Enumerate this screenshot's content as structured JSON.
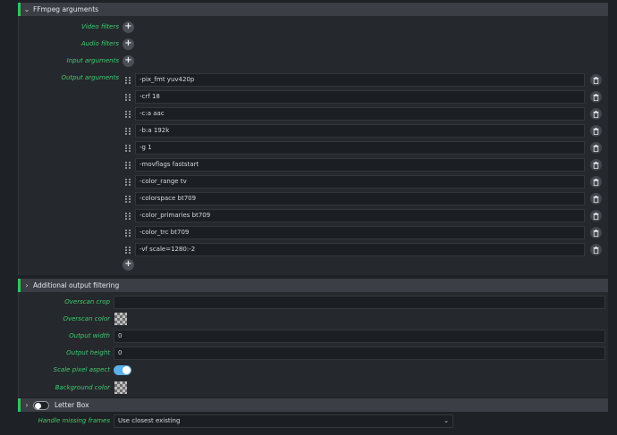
{
  "ffmpeg_section": {
    "title": "FFmpeg arguments",
    "video_filters_label": "Video filters",
    "audio_filters_label": "Audio filters",
    "input_arguments_label": "Input arguments",
    "output_arguments_label": "Output arguments",
    "add_symbol": "+",
    "output_arguments": [
      "-pix_fmt yuv420p",
      "-crf 18",
      "-c:a aac",
      "-b:a 192k",
      "-g 1",
      "-movflags faststart",
      "-color_range tv",
      "-colorspace bt709",
      "-color_primaries bt709",
      "-color_trc bt709",
      "-vf scale=1280:-2"
    ]
  },
  "additional_section": {
    "title": "Additional output filtering",
    "overscan_crop_label": "Overscan crop",
    "overscan_crop_value": "",
    "overscan_color_label": "Overscan color",
    "output_width_label": "Output width",
    "output_width_value": "0",
    "output_height_label": "Output height",
    "output_height_value": "0",
    "scale_pixel_aspect_label": "Scale pixel aspect",
    "scale_pixel_aspect_on": true,
    "background_color_label": "Background color"
  },
  "letterbox_section": {
    "title": "Letter Box",
    "enabled": false
  },
  "handle_missing": {
    "label": "Handle missing frames",
    "value": "Use closest existing"
  },
  "icons": {
    "expand_open": "chevron-down-icon",
    "expand_closed": "chevron-right-icon",
    "add": "plus-icon",
    "delete": "trash-icon",
    "drag": "drag-handle-icon"
  },
  "colors": {
    "accent": "#2ec65f",
    "label": "#3fcc6b",
    "toggle_on": "#5ab0ea"
  }
}
